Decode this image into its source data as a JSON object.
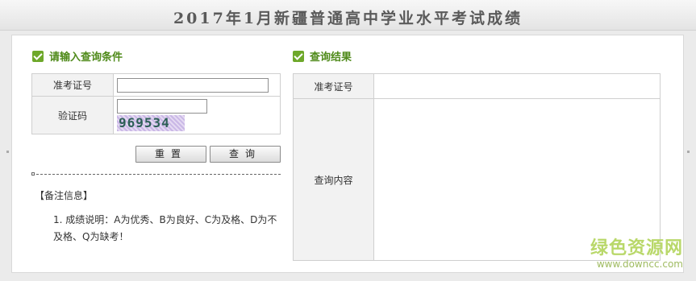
{
  "page_title": "2017年1月新疆普通高中学业水平考试成绩",
  "query_section": {
    "heading": "请输入查询条件",
    "exam_id_label": "准考证号",
    "exam_id_value": "",
    "captcha_label": "验证码",
    "captcha_value": "",
    "captcha_text": "969534",
    "reset_label": "重置",
    "query_label": "查询"
  },
  "notes": {
    "title": "【备注信息】",
    "items": [
      "1. 成绩说明：A为优秀、B为良好、C为及格、D为不及格、Q为缺考！"
    ]
  },
  "result_section": {
    "heading": "查询结果",
    "exam_id_label": "准考证号",
    "exam_id_value": "",
    "content_label": "查询内容",
    "content_value": ""
  },
  "watermark": {
    "name": "绿色资源网",
    "url": "www.downcc.com"
  },
  "colors": {
    "accent_green": "#4f8a1a",
    "icon_green": "#6ea82a",
    "label_bg": "#f2f2f2"
  },
  "icons": {
    "section_check": "check-box-icon"
  }
}
